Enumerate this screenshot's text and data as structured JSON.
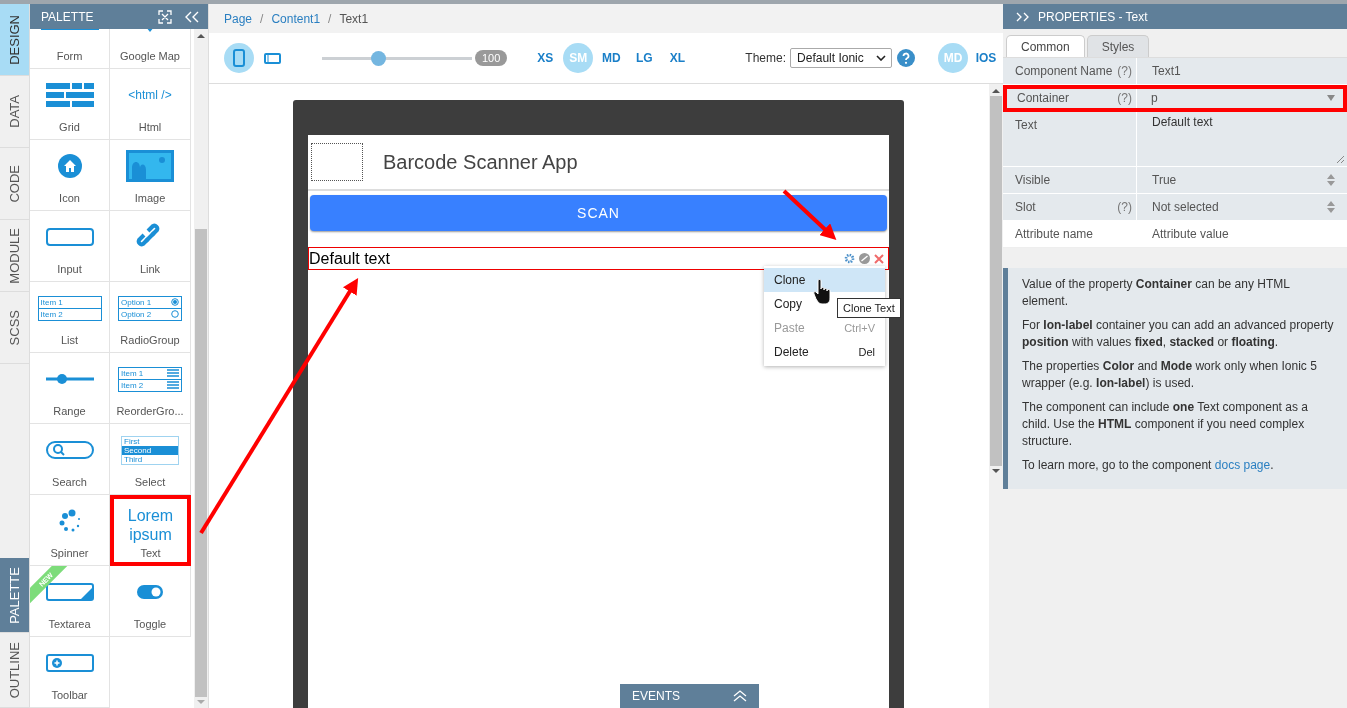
{
  "side_tabs_top": [
    {
      "label": "DESIGN",
      "selected": true
    },
    {
      "label": "DATA",
      "selected": false
    },
    {
      "label": "CODE",
      "selected": false
    },
    {
      "label": "MODULE",
      "selected": false
    },
    {
      "label": "SCSS",
      "selected": false
    }
  ],
  "side_tabs_bottom": [
    {
      "label": "PALETTE",
      "selected": true
    },
    {
      "label": "OUTLINE",
      "selected": false
    }
  ],
  "palette": {
    "title": "PALETTE",
    "items": [
      {
        "kind": "form",
        "label": "Form",
        "highlighted": false
      },
      {
        "kind": "map",
        "label": "Google Map",
        "highlighted": false
      },
      {
        "kind": "grid",
        "label": "Grid",
        "highlighted": false
      },
      {
        "kind": "html",
        "label": "Html",
        "preview": "<html />",
        "highlighted": false
      },
      {
        "kind": "icon",
        "label": "Icon",
        "highlighted": false
      },
      {
        "kind": "image",
        "label": "Image",
        "highlighted": false
      },
      {
        "kind": "input",
        "label": "Input",
        "highlighted": false
      },
      {
        "kind": "link",
        "label": "Link",
        "highlighted": false
      },
      {
        "kind": "list",
        "label": "List",
        "preview_lines": [
          "Item 1",
          "Item 2"
        ],
        "highlighted": false
      },
      {
        "kind": "radio",
        "label": "RadioGroup",
        "preview_lines": [
          "Option 1",
          "Option 2"
        ],
        "highlighted": false
      },
      {
        "kind": "range",
        "label": "Range",
        "highlighted": false
      },
      {
        "kind": "reorder",
        "label": "ReorderGro...",
        "preview_lines": [
          "Item 1",
          "Item 2"
        ],
        "highlighted": false
      },
      {
        "kind": "search",
        "label": "Search",
        "highlighted": false
      },
      {
        "kind": "select",
        "label": "Select",
        "preview_lines": [
          "First",
          "Second",
          "Third"
        ],
        "highlighted": false
      },
      {
        "kind": "spinner",
        "label": "Spinner",
        "highlighted": false
      },
      {
        "kind": "text",
        "label": "Text",
        "preview": "Lorem ipsum",
        "highlighted": true
      },
      {
        "kind": "textarea",
        "label": "Textarea",
        "badge": "NEW",
        "highlighted": false
      },
      {
        "kind": "toggle",
        "label": "Toggle",
        "highlighted": false
      },
      {
        "kind": "toolbar",
        "label": "Toolbar",
        "highlighted": false
      }
    ]
  },
  "breadcrumb": [
    {
      "label": "Page",
      "link": true
    },
    {
      "separator": "/",
      "label": "Content1",
      "link": true
    },
    {
      "separator": "/",
      "label": "Text1",
      "link": false
    }
  ],
  "toolbar": {
    "devices": [
      {
        "kind": "phone",
        "selected": true
      },
      {
        "kind": "tablet",
        "selected": false
      }
    ],
    "zoom": {
      "level": 0.37,
      "reading": "100"
    },
    "sizes": [
      {
        "label": "XS",
        "selected": false
      },
      {
        "label": "SM",
        "selected": true
      },
      {
        "label": "MD",
        "selected": false
      },
      {
        "label": "LG",
        "selected": false
      },
      {
        "label": "XL",
        "selected": false
      }
    ],
    "theme_label": "Theme:",
    "theme": "Default Ionic",
    "modes": [
      {
        "label": "MD",
        "selected": true
      },
      {
        "label": "IOS",
        "selected": false
      }
    ]
  },
  "app": {
    "title": "Barcode Scanner App",
    "button": "SCAN",
    "text": "Default text"
  },
  "context_menu": [
    {
      "label": "Clone",
      "highlighted": true,
      "disabled": false
    },
    {
      "label": "Copy",
      "highlighted": false,
      "disabled": false
    },
    {
      "label": "Paste",
      "shortcut": "Ctrl+V",
      "highlighted": false,
      "disabled": true
    },
    {
      "label": "Delete",
      "shortcut": "Del",
      "highlighted": false,
      "disabled": false
    }
  ],
  "tooltip": "Clone Text",
  "events_bar": "EVENTS",
  "properties": {
    "title": "PROPERTIES - Text",
    "tabs": [
      {
        "label": "Common",
        "selected": true
      },
      {
        "label": "Styles",
        "selected": false
      }
    ],
    "rows": [
      {
        "kind": "text",
        "label": "Component Name",
        "help": "(?)",
        "value": "Text1",
        "highlighted": false
      },
      {
        "kind": "dropdown",
        "label": "Container",
        "help": "(?)",
        "value": "p",
        "highlighted": true
      },
      {
        "kind": "textarea",
        "label": "Text",
        "value": "Default text",
        "highlighted": false
      },
      {
        "kind": "spinner",
        "label": "Visible",
        "value": "True",
        "highlighted": false
      },
      {
        "kind": "spinner",
        "label": "Slot",
        "help": "(?)",
        "value": "Not selected",
        "highlighted": false
      },
      {
        "kind": "attribute",
        "label": "Attribute name",
        "value": "Attribute value",
        "highlighted": false
      }
    ],
    "help": [
      "Value of the property **Container** can be any HTML element.",
      "For **Ion-label** container you can add an advanced property **position** with values **fixed**, **stacked** or **floating**.",
      "The properties **Color** and **Mode** work only when Ionic 5 wrapper (e.g. **Ion-label**) is used.",
      "The component can include **one** Text component as a child. Use the **HTML** component if you need complex structure."
    ],
    "help_more": {
      "before": "To learn more, go to the component ",
      "link": "docs page",
      "after": "."
    }
  }
}
